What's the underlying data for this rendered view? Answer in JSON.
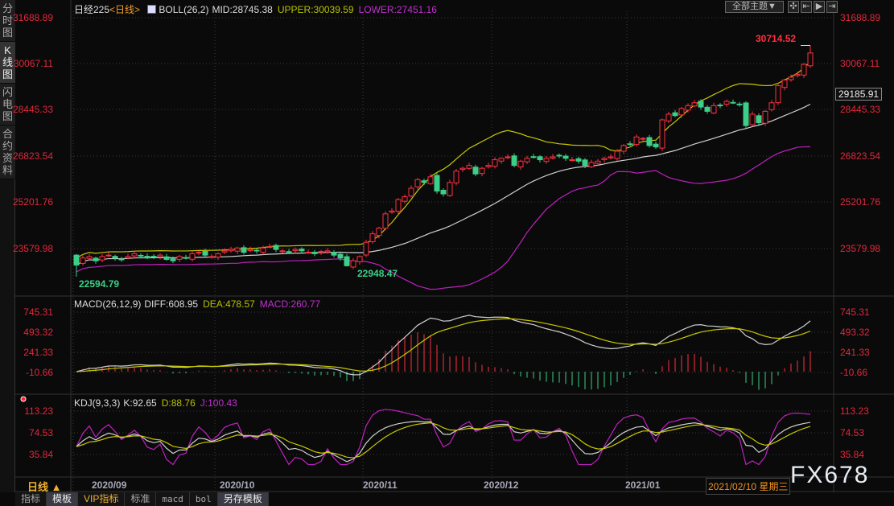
{
  "sidebar": {
    "tabs": [
      {
        "label": [
          "分",
          "时",
          "图"
        ]
      },
      {
        "label": [
          "K",
          "线",
          "图"
        ]
      },
      {
        "label": [
          "闪",
          "电",
          "图"
        ]
      },
      {
        "label": [
          "合",
          "约",
          "资",
          "料"
        ]
      }
    ]
  },
  "main": {
    "instrument": "日经225",
    "period": "<日线>",
    "indicator": "BOLL(26,2)",
    "mid": "MID:28745.38",
    "upper": "UPPER:30039.59",
    "lower": "LOWER:27451.16",
    "y_ticks": [
      "31688.89",
      "30067.11",
      "28445.33",
      "26823.54",
      "25201.76",
      "23579.98"
    ],
    "current_price": "29185.91",
    "high_label": "30714.52",
    "low_labels": [
      "22594.79",
      "22948.47"
    ]
  },
  "toolbar": {
    "theme_select": "全部主题▼"
  },
  "macd": {
    "title": "MACD(26,12,9)",
    "diff": "DIFF:608.95",
    "dea": "DEA:478.57",
    "macd": "MACD:260.77",
    "y_ticks": [
      "745.31",
      "493.32",
      "241.33",
      "-10.66"
    ]
  },
  "kdj": {
    "title": "KDJ(9,3,3)",
    "k": "K:92.65",
    "d": "D:88.76",
    "j": "J:100.43",
    "y_ticks": [
      "113.23",
      "74.53",
      "35.84"
    ]
  },
  "xaxis": {
    "period_label": "日线 ▲",
    "dates": [
      "2020/09",
      "2020/10",
      "2020/11",
      "2020/12",
      "2021/01"
    ],
    "cursor_date": "2021/02/10 星期三"
  },
  "watermark": "FX678",
  "bottom_tabs": [
    "指标",
    "模板",
    "VIP指标",
    "标准",
    "macd",
    "bol",
    "另存模板"
  ],
  "colors": {
    "up": "#ff3040",
    "down": "#3ccf88",
    "mid": "#d0d0d0",
    "upper": "#c8c800",
    "lower": "#c020c0"
  },
  "chart_data": {
    "type": "candlestick",
    "title": "日经225 日线",
    "month_start_index": [
      0,
      22,
      45,
      65,
      86
    ],
    "closes": [
      23000,
      23250,
      23300,
      23150,
      23300,
      23350,
      23250,
      23200,
      23300,
      23400,
      23320,
      23250,
      23300,
      23350,
      23200,
      23150,
      23300,
      23250,
      23400,
      23450,
      23350,
      23300,
      23400,
      23500,
      23550,
      23600,
      23450,
      23550,
      23500,
      23600,
      23650,
      23550,
      23500,
      23450,
      23550,
      23500,
      23450,
      23400,
      23480,
      23500,
      23350,
      23250,
      22977,
      23150,
      23300,
      23800,
      24100,
      24300,
      24800,
      24900,
      25300,
      25400,
      25700,
      26000,
      25900,
      26100,
      25600,
      25500,
      25900,
      26300,
      26400,
      26500,
      26200,
      26400,
      26500,
      26700,
      26750,
      26800,
      26500,
      26650,
      26750,
      26800,
      26700,
      26750,
      26800,
      26850,
      26750,
      26700,
      26650,
      26500,
      26600,
      26650,
      26750,
      26800,
      27000,
      27200,
      27250,
      27500,
      27450,
      27200,
      27150,
      28100,
      28300,
      28250,
      28500,
      28600,
      28700,
      28550,
      28400,
      28600,
      28600,
      28750,
      28700,
      28650,
      27900,
      28300,
      28000,
      28400,
      28700,
      29300,
      29500,
      29600,
      29700,
      30050,
      30450
    ],
    "first_open": 23350,
    "last_high": 30714.52,
    "main_ylim": [
      22000,
      31900
    ],
    "macd_ylim": [
      -200,
      800
    ],
    "kdj_ylim": [
      20,
      120
    ]
  }
}
